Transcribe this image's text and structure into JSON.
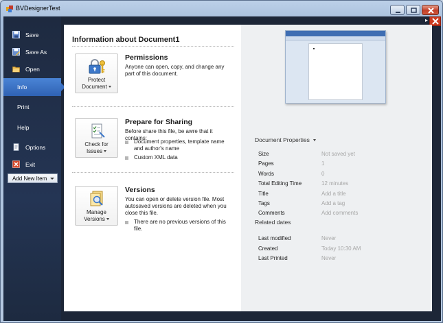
{
  "window": {
    "title": "BVDesignerTest",
    "controls": {
      "minimize": "minimize-icon",
      "maximize": "maximize-icon",
      "close": "close-icon"
    }
  },
  "nav": {
    "items": [
      {
        "label": "Save",
        "icon": "save-icon"
      },
      {
        "label": "Save As",
        "icon": "save-as-icon"
      },
      {
        "label": "Open",
        "icon": "open-folder-icon"
      },
      {
        "label": "Info",
        "active": true
      },
      {
        "label": "Print"
      },
      {
        "label": "Help"
      },
      {
        "label": "Options",
        "icon": "options-icon"
      },
      {
        "label": "Exit",
        "icon": "exit-icon"
      }
    ],
    "add_new_item": "Add New Item"
  },
  "info": {
    "title": "Information about Document1",
    "sections": [
      {
        "button_line1": "Protect",
        "button_line2": "Document",
        "title": "Permissions",
        "description": "Anyone can open, copy, and change any part of this document.",
        "icon": "lock-key-icon"
      },
      {
        "button_line1": "Check for",
        "button_line2": "Issues",
        "title": "Prepare for Sharing",
        "description": "Before share this file, be awre that it contains:",
        "bullets": [
          "Document properties, template name and author's name",
          "Custom XML data"
        ],
        "icon": "checklist-icon"
      },
      {
        "button_line1": "Manage",
        "button_line2": "Versions",
        "title": "Versions",
        "description": "You can open or delete version file. Most autosaved versions are deleted when you close this file.",
        "bullets": [
          "There are no previous versions of this file."
        ],
        "icon": "manage-versions-icon"
      }
    ]
  },
  "properties": {
    "header": "Document Properties",
    "rows": [
      {
        "key": "Size",
        "value": "Not saved yet"
      },
      {
        "key": "Pages",
        "value": "1"
      },
      {
        "key": "Words",
        "value": "0"
      },
      {
        "key": "Total Editing Time",
        "value": "12 minutes"
      },
      {
        "key": "Title",
        "value": "Add a title"
      },
      {
        "key": "Tags",
        "value": "Add a tag"
      },
      {
        "key": "Comments",
        "value": "Add comments"
      }
    ],
    "related_header": "Related dates",
    "dates": [
      {
        "key": "Last modified",
        "value": "Never"
      },
      {
        "key": "Created",
        "value": "Today 10:30 AM"
      },
      {
        "key": "Last Printed",
        "value": "Never"
      }
    ]
  },
  "colors": {
    "nav_bg": "#243554",
    "nav_active": "#3a6fc2",
    "right_pane_bg": "#eef0f2",
    "placeholder_text": "#a7a7a7",
    "close_red": "#cc3a1f"
  }
}
